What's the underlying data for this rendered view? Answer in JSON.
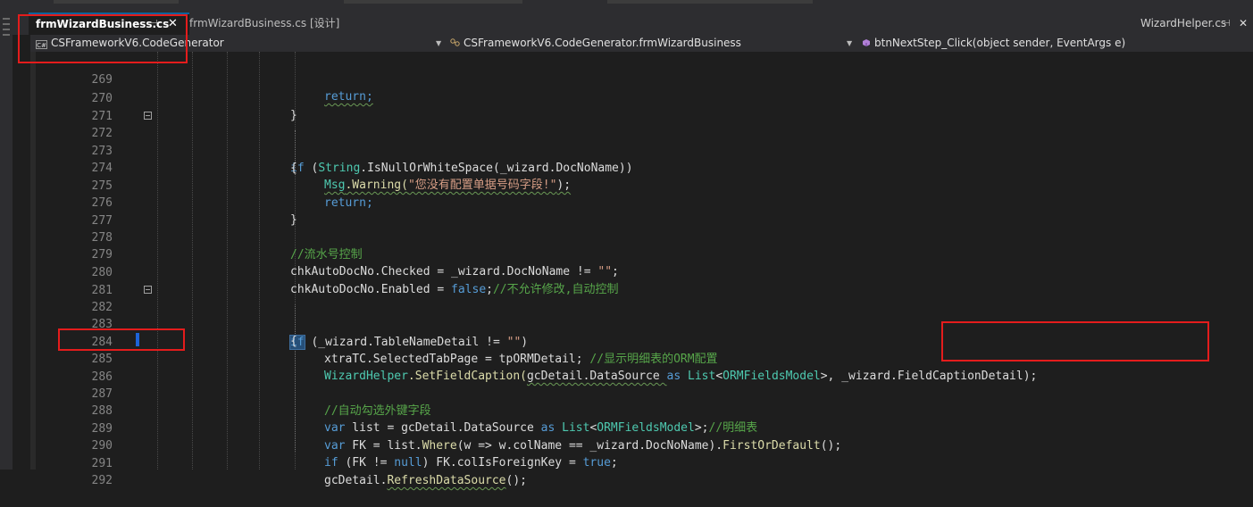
{
  "tabs": {
    "active": {
      "label": "frmWizardBusiness.cs",
      "pin_icon": "pin-icon",
      "close_icon": "close-icon"
    },
    "inactive": {
      "label": "frmWizardBusiness.cs [设计]"
    },
    "right": {
      "label": "WizardHelper.cs",
      "pin_icon": "pin-icon",
      "close_icon": "close-icon"
    }
  },
  "navbar": {
    "project": "CSFrameworkV6.CodeGenerator",
    "class": "CSFrameworkV6.CodeGenerator.frmWizardBusiness",
    "member": "btnNextStep_Click(object sender, EventArgs e)"
  },
  "colors": {
    "accent": "#0e639c",
    "highlight_box": "#e41c1c"
  },
  "editor": {
    "lines": [
      {
        "n": "269"
      },
      {
        "n": "270"
      },
      {
        "n": "271"
      },
      {
        "n": "272"
      },
      {
        "n": "273"
      },
      {
        "n": "274"
      },
      {
        "n": "275"
      },
      {
        "n": "276"
      },
      {
        "n": "277"
      },
      {
        "n": "278"
      },
      {
        "n": "279"
      },
      {
        "n": "280"
      },
      {
        "n": "281"
      },
      {
        "n": "282"
      },
      {
        "n": "283"
      },
      {
        "n": "284"
      },
      {
        "n": "285"
      },
      {
        "n": "286"
      },
      {
        "n": "287"
      },
      {
        "n": "288"
      },
      {
        "n": "289"
      },
      {
        "n": "290"
      },
      {
        "n": "291"
      },
      {
        "n": "292"
      }
    ],
    "tokens": {
      "return": "return;",
      "brace_close": "}",
      "brace_open": "{",
      "if": "if",
      "paren_open": " (",
      "string_type": "String",
      "isnull": ".IsNullOrWhiteSpace(",
      "wiz_docno_close": "_wizard.DocNoName))",
      "msg": "Msg",
      "warning": ".Warning(",
      "warning_str": "\"您没有配置单据号码字段!\"",
      "end_paren_semi": ");",
      "cm_serial": "//流水号控制",
      "chk_checked": "chkAutoDocNo.Checked = ",
      "wiz_docno_ne": "_wizard.DocNoName != ",
      "empty_str": "\"\"",
      "semi": ";",
      "chk_enabled": "chkAutoDocNo.Enabled = ",
      "false": "false",
      "cm_noedit": "//不允许修改,自动控制",
      "wiz_tabledetail": " (_wizard.TableNameDetail != ",
      "close_paren": ")",
      "xtra_sel": "xtraTC.SelectedTabPage = tpORMDetail; ",
      "cm_orm": "//显示明细表的ORM配置",
      "wizardhelper": "WizardHelper",
      "setfield": ".SetFieldCaption(",
      "gcdetail_ds": "gcDetail.DataSource ",
      "as": "as",
      "list_type": "List",
      "lt": "<",
      "orm_model": "ORMFieldsModel",
      "gt_comma": ">, ",
      "wiz_fieldcap": "_wizard.FieldCaptionDetail",
      "cm_auto_fk": "//自动勾选外键字段",
      "var": "var",
      "list_eq": " list = gcDetail.DataSource ",
      "gt_semi": ">;",
      "cm_detail": "//明细表",
      "fk_eq": " FK = list.",
      "where": "Where",
      "lambda_1": "(w => w.colName == _wizard.DocNoName).",
      "firstordefault": "FirstOrDefault",
      "call_end": "();",
      "fk_notnull_1": " (FK != ",
      "null": "null",
      "fk_notnull_2": ") FK.colIsForeignKey = ",
      "true": "true",
      "gcdetail": "gcDetail.",
      "refresh": "RefreshDataSource"
    }
  }
}
